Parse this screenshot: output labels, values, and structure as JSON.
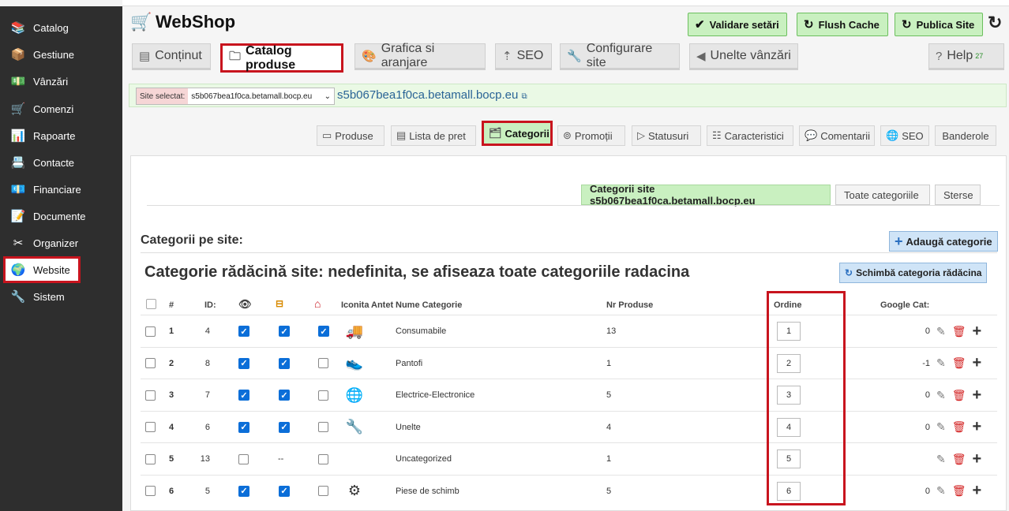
{
  "sidebar": {
    "items": [
      {
        "label": "Catalog",
        "icon": "catalog-icon",
        "glyph": "📚"
      },
      {
        "label": "Gestiune",
        "icon": "stock-icon",
        "glyph": "📦"
      },
      {
        "label": "Vânzări",
        "icon": "sales-icon",
        "glyph": "💵"
      },
      {
        "label": "Comenzi",
        "icon": "cart-icon",
        "glyph": "🛒"
      },
      {
        "label": "Rapoarte",
        "icon": "report-icon",
        "glyph": "📊"
      },
      {
        "label": "Contacte",
        "icon": "contacts-icon",
        "glyph": "📇"
      },
      {
        "label": "Financiare",
        "icon": "money-icon",
        "glyph": "💶"
      },
      {
        "label": "Documente",
        "icon": "documents-icon",
        "glyph": "📝"
      },
      {
        "label": "Organizer",
        "icon": "organizer-icon",
        "glyph": "✂"
      },
      {
        "label": "Website",
        "icon": "globe-icon",
        "glyph": "🌍"
      },
      {
        "label": "Sistem",
        "icon": "tools-icon",
        "glyph": "🔧"
      }
    ],
    "active": "Website"
  },
  "header": {
    "brand": "WebShop",
    "buttons": {
      "validate": "Validare setări",
      "flush": "Flush Cache",
      "publish": "Publica Site"
    }
  },
  "main_tabs": {
    "continut": "Conținut",
    "catalog": "Catalog produse",
    "grafica": "Grafica si aranjare",
    "seo": "SEO",
    "config": "Configurare site",
    "unelte": "Unelte vânzări",
    "help": "Help",
    "help_count": "27"
  },
  "site": {
    "label": "Site selectat:",
    "value": "s5b067bea1f0ca.betamall.bocp.eu",
    "url": "s5b067bea1f0ca.betamall.bocp.eu"
  },
  "sub_tabs": {
    "produse": "Produse",
    "lista": "Lista de pret",
    "categorii": "Categorii",
    "promotii": "Promoții",
    "statusuri": "Statusuri",
    "caracteristici": "Caracteristici",
    "comentarii": "Comentarii",
    "seo": "SEO",
    "banderole": "Banderole"
  },
  "panel": {
    "tabs": {
      "site": "Categorii site s5b067bea1f0ca.betamall.bocp.eu",
      "all": "Toate categoriile",
      "deleted": "Sterse"
    },
    "title": "Categorii pe site:",
    "add": "Adaugă categorie",
    "root_title": "Categorie rădăcină site: nedefinita, se afiseaza toate categoriile radacina",
    "change_root": "Schimbă categoria rădăcina"
  },
  "table": {
    "headers": {
      "num": "#",
      "id": "ID:",
      "icon": "Iconita",
      "antet": "Antet",
      "name": "Nume Categorie",
      "count": "Nr Produse",
      "order": "Ordine",
      "google": "Google Cat:"
    },
    "rows": [
      {
        "num": "1",
        "id": "4",
        "vis": true,
        "menu": true,
        "home": true,
        "img": "🚚",
        "name": "Consumabile",
        "count": "13",
        "order": "1",
        "google": "0"
      },
      {
        "num": "2",
        "id": "8",
        "vis": true,
        "menu": true,
        "home": false,
        "img": "👟",
        "name": "Pantofi",
        "count": "1",
        "order": "2",
        "google": "-1"
      },
      {
        "num": "3",
        "id": "7",
        "vis": true,
        "menu": true,
        "home": false,
        "img": "🌐",
        "name": "Electrice-Electronice",
        "count": "5",
        "order": "3",
        "google": "0"
      },
      {
        "num": "4",
        "id": "6",
        "vis": true,
        "menu": true,
        "home": false,
        "img": "🔧",
        "name": "Unelte",
        "count": "4",
        "order": "4",
        "google": "0"
      },
      {
        "num": "5",
        "id": "13",
        "vis": false,
        "menu": null,
        "home": false,
        "img": "",
        "name": "Uncategorized",
        "count": "1",
        "order": "5",
        "google": ""
      },
      {
        "num": "6",
        "id": "5",
        "vis": true,
        "menu": true,
        "home": false,
        "img": "⚙",
        "name": "Piese de schimb",
        "count": "5",
        "order": "6",
        "google": "0"
      }
    ]
  },
  "colors": {
    "accent_green": "#c9f0c0",
    "highlight_red": "#c8141e",
    "checkbox_blue": "#0b6ed8"
  }
}
